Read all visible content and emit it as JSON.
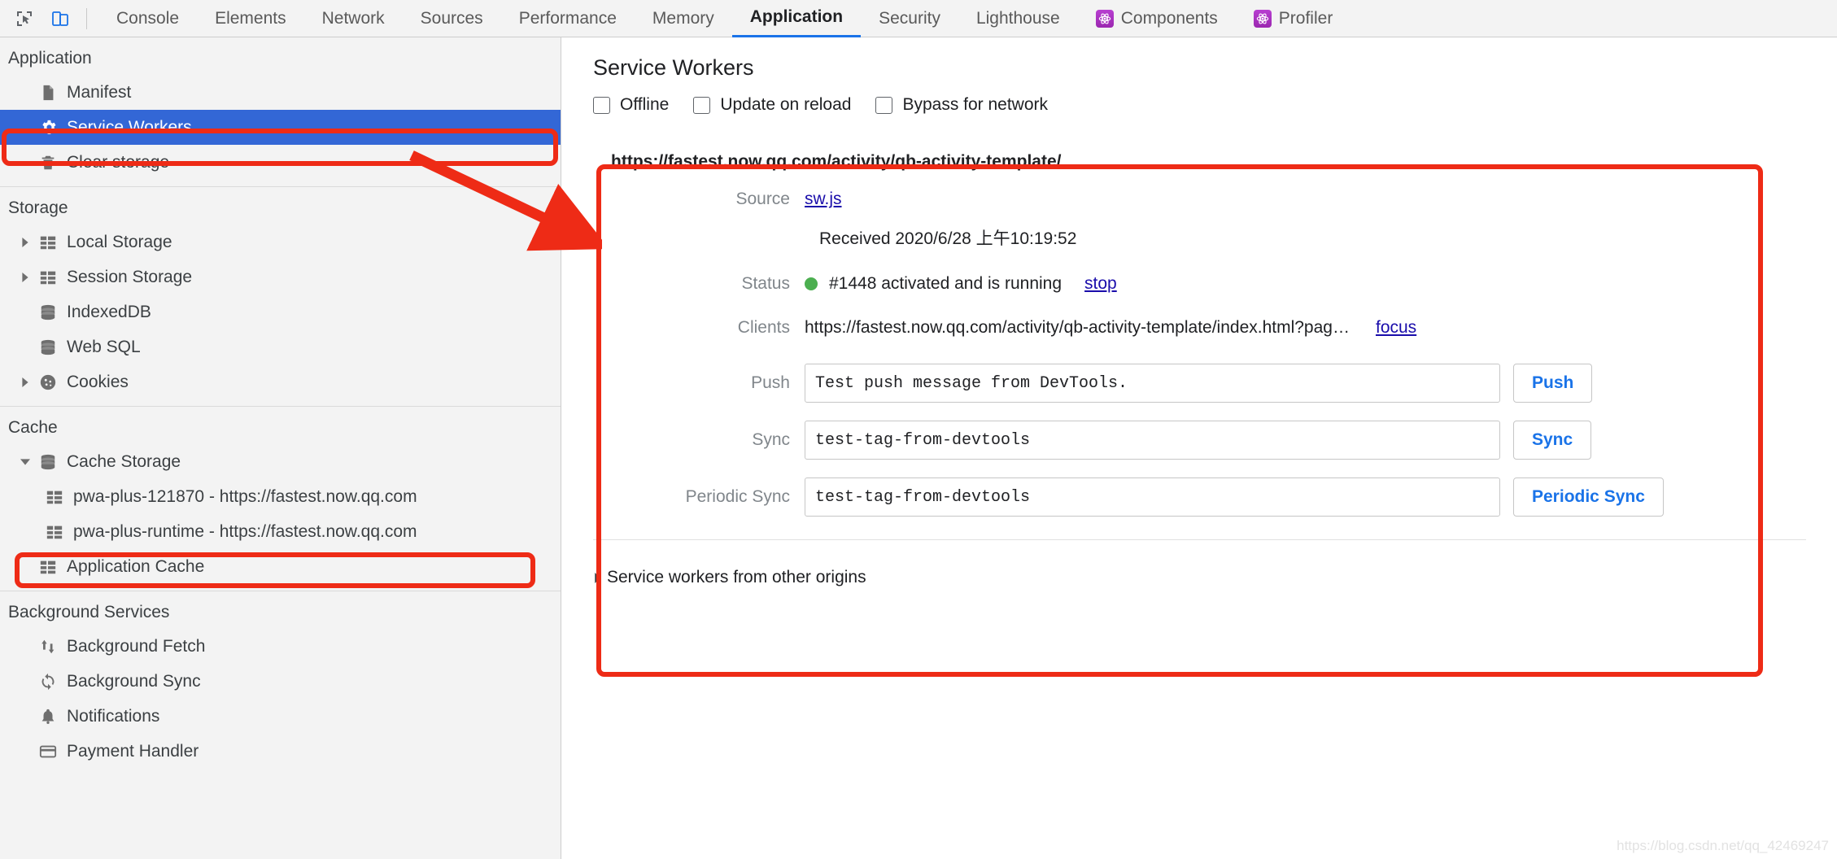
{
  "toolbar": {
    "icons": [
      {
        "name": "inspect-element-icon",
        "label": "Inspect element"
      },
      {
        "name": "device-toolbar-icon",
        "label": "Toggle device toolbar"
      }
    ],
    "tabs": [
      {
        "label": "Console",
        "active": false,
        "icon": null
      },
      {
        "label": "Elements",
        "active": false,
        "icon": null
      },
      {
        "label": "Network",
        "active": false,
        "icon": null
      },
      {
        "label": "Sources",
        "active": false,
        "icon": null
      },
      {
        "label": "Performance",
        "active": false,
        "icon": null
      },
      {
        "label": "Memory",
        "active": false,
        "icon": null
      },
      {
        "label": "Application",
        "active": true,
        "icon": null
      },
      {
        "label": "Security",
        "active": false,
        "icon": null
      },
      {
        "label": "Lighthouse",
        "active": false,
        "icon": null
      },
      {
        "label": "Components",
        "active": false,
        "icon": "react-atom-icon"
      },
      {
        "label": "Profiler",
        "active": false,
        "icon": "react-atom-icon"
      }
    ]
  },
  "sidebar": {
    "groups": [
      {
        "title": "Application",
        "items": [
          {
            "label": "Manifest",
            "icon": "document-icon",
            "arrow": "none",
            "indent": 1,
            "selected": false
          },
          {
            "label": "Service Workers",
            "icon": "gear-icon",
            "arrow": "none",
            "indent": 1,
            "selected": true
          },
          {
            "label": "Clear storage",
            "icon": "trash-icon",
            "arrow": "none",
            "indent": 1,
            "selected": false
          }
        ]
      },
      {
        "title": "Storage",
        "items": [
          {
            "label": "Local Storage",
            "icon": "table-icon",
            "arrow": "collapsed",
            "indent": 1,
            "selected": false
          },
          {
            "label": "Session Storage",
            "icon": "table-icon",
            "arrow": "collapsed",
            "indent": 1,
            "selected": false
          },
          {
            "label": "IndexedDB",
            "icon": "database-icon",
            "arrow": "none",
            "indent": 1,
            "selected": false
          },
          {
            "label": "Web SQL",
            "icon": "database-icon",
            "arrow": "none",
            "indent": 1,
            "selected": false
          },
          {
            "label": "Cookies",
            "icon": "cookie-icon",
            "arrow": "collapsed",
            "indent": 1,
            "selected": false
          }
        ]
      },
      {
        "title": "Cache",
        "items": [
          {
            "label": "Cache Storage",
            "icon": "database-icon",
            "arrow": "expanded",
            "indent": 1,
            "selected": false
          },
          {
            "label": "pwa-plus-121870 - https://fastest.now.qq.com",
            "icon": "table-icon",
            "arrow": "none",
            "indent": 2,
            "selected": false
          },
          {
            "label": "pwa-plus-runtime - https://fastest.now.qq.com",
            "icon": "table-icon",
            "arrow": "none",
            "indent": 2,
            "selected": false
          },
          {
            "label": "Application Cache",
            "icon": "table-icon",
            "arrow": "none",
            "indent": 1,
            "selected": false
          }
        ]
      },
      {
        "title": "Background Services",
        "items": [
          {
            "label": "Background Fetch",
            "icon": "up-down-arrows-icon",
            "arrow": "none",
            "indent": 1,
            "selected": false
          },
          {
            "label": "Background Sync",
            "icon": "sync-icon",
            "arrow": "none",
            "indent": 1,
            "selected": false
          },
          {
            "label": "Notifications",
            "icon": "bell-icon",
            "arrow": "none",
            "indent": 1,
            "selected": false
          },
          {
            "label": "Payment Handler",
            "icon": "credit-card-icon",
            "arrow": "none",
            "indent": 1,
            "selected": false
          }
        ]
      }
    ]
  },
  "main": {
    "title": "Service Workers",
    "checkboxes": [
      {
        "label": "Offline",
        "checked": false
      },
      {
        "label": "Update on reload",
        "checked": false
      },
      {
        "label": "Bypass for network",
        "checked": false
      }
    ],
    "worker": {
      "scope_url": "https://fastest.now.qq.com/activity/qb-activity-template/",
      "source_label": "Source",
      "source_link": "sw.js",
      "received": "Received 2020/6/28 上午10:19:52",
      "status_label": "Status",
      "status_text": "#1448 activated and is running",
      "status_action": "stop",
      "status_color": "#4caf50",
      "clients_label": "Clients",
      "clients_url": "https://fastest.now.qq.com/activity/qb-activity-template/index.html?pag…",
      "clients_action": "focus",
      "push_label": "Push",
      "push_value": "Test push message from DevTools.",
      "push_button": "Push",
      "sync_label": "Sync",
      "sync_value": "test-tag-from-devtools",
      "sync_button": "Sync",
      "periodic_sync_label": "Periodic Sync",
      "periodic_sync_value": "test-tag-from-devtools",
      "periodic_sync_button": "Periodic Sync"
    },
    "other_origins_label": "Service workers from other origins"
  },
  "annotations": {
    "accent_color": "#ee2b16",
    "highlight_service_workers": true,
    "highlight_cache_entry": true,
    "highlight_worker_card": true,
    "arrow_from_sidebar_to_card": true
  },
  "watermark": "https://blog.csdn.net/qq_42469247"
}
